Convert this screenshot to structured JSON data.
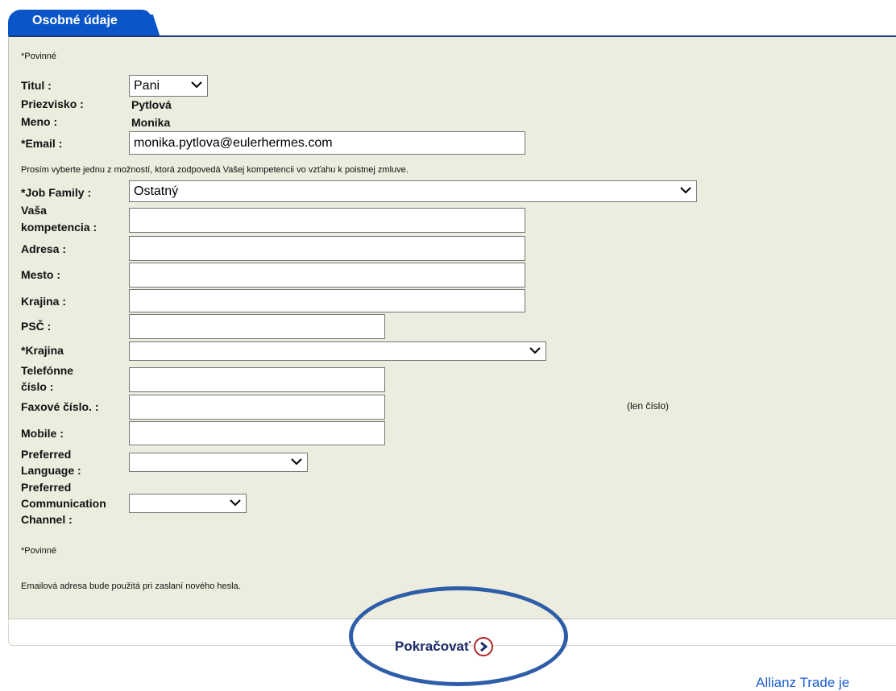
{
  "tab": {
    "label": "Osobné údaje"
  },
  "required_note_top": "*Povinné",
  "fields": {
    "titul": {
      "label": "Titul :",
      "value": "Pani"
    },
    "priezvisko": {
      "label": "Priezvisko :",
      "value": "Pytlová"
    },
    "meno": {
      "label": "Meno :",
      "value": "Monika"
    },
    "email": {
      "label": "*Email :",
      "value": "monika.pytlova@eulerhermes.com"
    },
    "job_family": {
      "label": "*Job Family :",
      "value": "Ostatný"
    },
    "kompetencia": {
      "label_1": "Vaša",
      "label_2": "kompetencia :",
      "value": ""
    },
    "adresa": {
      "label": "Adresa :",
      "value": ""
    },
    "mesto": {
      "label": "Mesto :",
      "value": ""
    },
    "krajina_text": {
      "label": "Krajina :",
      "value": ""
    },
    "psc": {
      "label": "PSČ :",
      "value": ""
    },
    "krajina_select": {
      "label": "*Krajina",
      "value": ""
    },
    "telefon": {
      "label_1": "Telefónne",
      "label_2": "číslo :",
      "value": ""
    },
    "fax": {
      "label": "Faxové číslo. :",
      "value": "",
      "hint": "(len číslo)"
    },
    "mobile": {
      "label": "Mobile :",
      "value": ""
    },
    "language": {
      "label_1": "Preferred",
      "label_2": "Language :",
      "value": ""
    },
    "channel": {
      "label_1": "Preferred",
      "label_2": "Communication",
      "label_3": "Channel :",
      "value": ""
    }
  },
  "job_instruction": "Prosím vyberte jednu z možností, ktorá zodpovedá Vašej kompetencii vo vzťahu k poistnej zmluve.",
  "required_note_bottom": "*Povinné",
  "email_note": "Emailová adresa bude použitá pri zaslaní nového hesla.",
  "continue_button": {
    "label": "Pokračovať"
  },
  "footer_link": "Allianz Trade je",
  "colors": {
    "tab": "#0a55c8",
    "panel": "#ececdf",
    "button_text": "#1b2a6b",
    "highlight_ellipse": "#2e5ea8"
  }
}
